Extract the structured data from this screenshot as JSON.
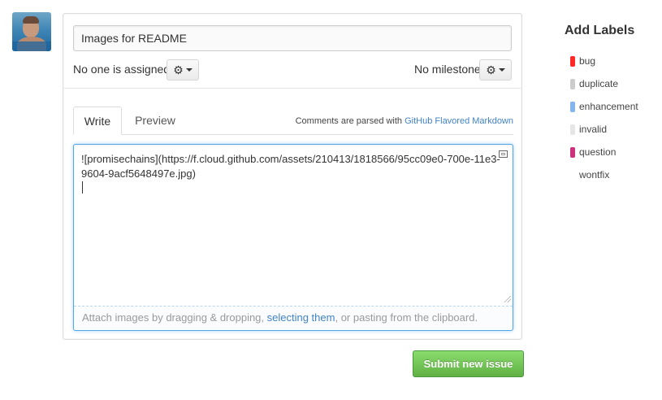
{
  "issue": {
    "title_value": "Images for README",
    "assignee_text": "No one is assigned",
    "milestone_text": "No milestone"
  },
  "tabs": [
    {
      "label": "Write",
      "active": true
    },
    {
      "label": "Preview",
      "active": false
    }
  ],
  "markdown_note": {
    "prefix": "Comments are parsed with ",
    "link": "GitHub Flavored Markdown"
  },
  "editor": {
    "body_value": "![promisechains](https://f.cloud.github.com/assets/210413/1818566/95cc09e0-700e-11e3-9604-9acf5648497e.jpg)\n"
  },
  "attach": {
    "before": "Attach images by dragging & dropping, ",
    "link": "selecting them",
    "after": ", or pasting from the clipboard."
  },
  "submit_label": "Submit new issue",
  "sidebar": {
    "title": "Add Labels",
    "labels": [
      {
        "name": "bug",
        "color": "#fc2929"
      },
      {
        "name": "duplicate",
        "color": "#cccccc"
      },
      {
        "name": "enhancement",
        "color": "#84b6eb"
      },
      {
        "name": "invalid",
        "color": "#e6e6e6"
      },
      {
        "name": "question",
        "color": "#cc317c"
      },
      {
        "name": "wontfix",
        "color": "#ffffff"
      }
    ]
  },
  "icons": {
    "gear": "gear-icon",
    "caret": "chevron-down-icon",
    "fullscreen": "fullscreen-icon"
  }
}
